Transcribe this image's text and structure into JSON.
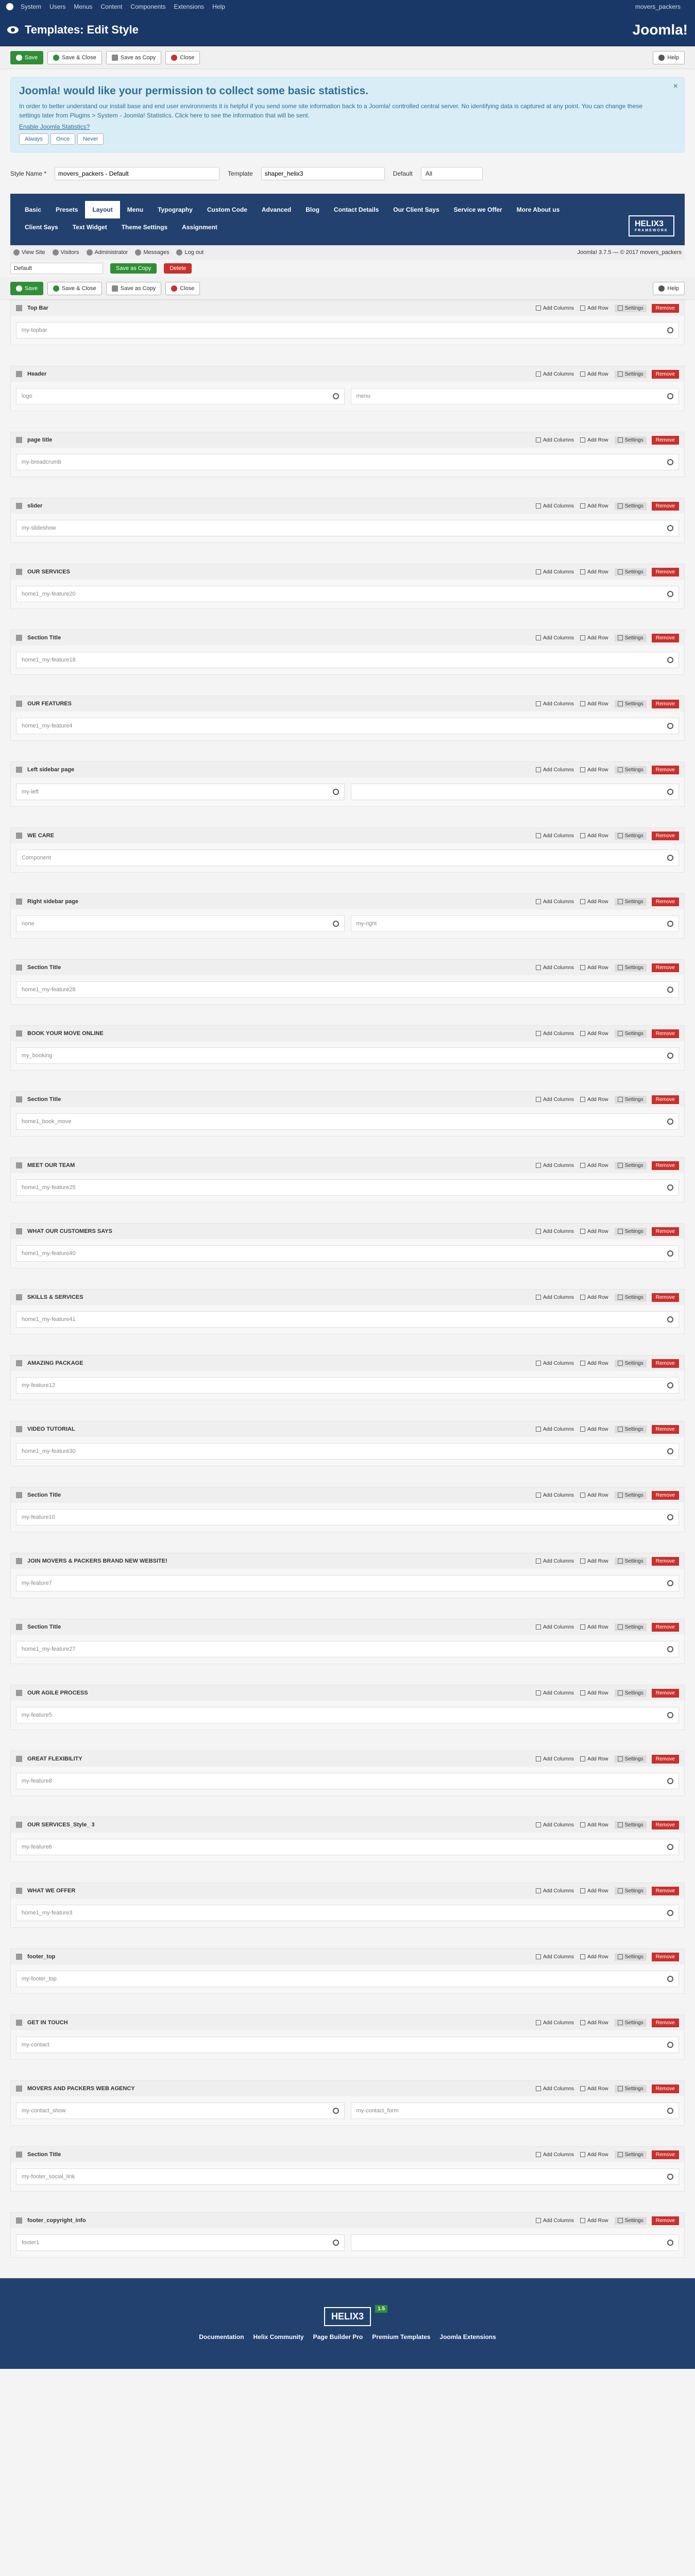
{
  "topmenu": {
    "items": [
      "System",
      "Users",
      "Menus",
      "Content",
      "Components",
      "Extensions",
      "Help"
    ],
    "right": "movers_packers"
  },
  "title": "Templates: Edit Style",
  "brand": "Joomla!",
  "toolbar": {
    "save": "Save",
    "save_close": "Save & Close",
    "save_copy": "Save as Copy",
    "close": "Close",
    "help": "Help"
  },
  "alert": {
    "heading": "Joomla! would like your permission to collect some basic statistics.",
    "text": "In order to better understand our install base and end user environments it is helpful if you send some site information back to a Joomla! controlled central server. No identifying data is captured at any point. You can change these settings later from Plugins > System - Joomla! Statistics. Click here to see the information that will be sent.",
    "link": "Enable Joomla Statistics?",
    "always": "Always",
    "once": "Once",
    "never": "Never"
  },
  "fields": {
    "style_label": "Style Name *",
    "style_value": "movers_packers - Default",
    "template_label": "Template",
    "template_value": "shaper_helix3",
    "default_label": "Default",
    "default_value": "All"
  },
  "tabs": [
    "Basic",
    "Presets",
    "Layout",
    "Menu",
    "Typography",
    "Custom Code",
    "Advanced",
    "Blog",
    "Contact Details",
    "Our Client Says",
    "Service we Offer",
    "More About us",
    "Client Says",
    "Text Widget",
    "Theme Settings",
    "Assignment"
  ],
  "helix": {
    "name": "HELIX3",
    "sub": "FRAMEWORK"
  },
  "subbar": {
    "view_site": "View Site",
    "visitors": "Visitors",
    "administrator": "Administrator",
    "messages": "Messages",
    "logout": "Log out",
    "right": "Joomla! 3.7.5 — © 2017 movers_packers"
  },
  "mini": {
    "select": "Default",
    "save_copy": "Save as Copy",
    "delete": "Delete"
  },
  "actions": {
    "add_columns": "Add Columns",
    "add_row": "Add Row",
    "settings": "Settings",
    "remove": "Remove"
  },
  "sections": [
    {
      "title": "Top Bar",
      "cols": [
        "my-topbar"
      ]
    },
    {
      "title": "Header",
      "cols": [
        "logo",
        "menu"
      ]
    },
    {
      "title": "page title",
      "cols": [
        "my-breadcrumb"
      ]
    },
    {
      "title": "slider",
      "cols": [
        "my-slideshow"
      ]
    },
    {
      "title": "OUR SERVICES",
      "cols": [
        "home1_my-feature20"
      ]
    },
    {
      "title": "Section Title",
      "cols": [
        "home1_my-feature18"
      ]
    },
    {
      "title": "OUR FEATURES",
      "cols": [
        "home1_my-feature4"
      ]
    },
    {
      "title": "Left sidebar page",
      "cols": [
        "my-left",
        ""
      ]
    },
    {
      "title": "WE CARE",
      "cols": [
        "Component"
      ]
    },
    {
      "title": "Right sidebar page",
      "cols": [
        "none",
        "my-right"
      ]
    },
    {
      "title": "Section Title",
      "cols": [
        "home1_my-feature28"
      ]
    },
    {
      "title": "BOOK YOUR MOVE ONLINE",
      "cols": [
        "my_booking"
      ]
    },
    {
      "title": "Section Title",
      "cols": [
        "home1_book_move"
      ]
    },
    {
      "title": "MEET OUR TEAM",
      "cols": [
        "home1_my-feature25"
      ]
    },
    {
      "title": "WHAT OUR CUSTOMERS SAYS",
      "cols": [
        "home1_my-feature40"
      ]
    },
    {
      "title": "SKILLS & SERVICES",
      "cols": [
        "home1_my-feature41"
      ]
    },
    {
      "title": "AMAZING PACKAGE",
      "cols": [
        "my-feature12"
      ]
    },
    {
      "title": "VIDEO TUTORIAL",
      "cols": [
        "home1_my-feature30"
      ]
    },
    {
      "title": "Section Title",
      "cols": [
        "my-feature10"
      ]
    },
    {
      "title": "JOIN MOVERS & PACKERS BRAND NEW WEBSITE!",
      "cols": [
        "my-feature7"
      ]
    },
    {
      "title": "Section Title",
      "cols": [
        "home1_my-feature27"
      ]
    },
    {
      "title": "OUR AGILE PROCESS",
      "cols": [
        "my-feature5"
      ]
    },
    {
      "title": "GREAT FLEXIBILITY",
      "cols": [
        "my-feature8"
      ]
    },
    {
      "title": "OUR SERVICES_Style_ 3",
      "cols": [
        "my-feature6"
      ]
    },
    {
      "title": "WHAT WE OFFER",
      "cols": [
        "home1_my-feature3"
      ]
    },
    {
      "title": "footer_top",
      "cols": [
        "my-footer_top"
      ]
    },
    {
      "title": "GET IN TOUCH",
      "cols": [
        "my-contact"
      ]
    },
    {
      "title": "MOVERS AND PACKERS WEB AGENCY",
      "cols": [
        "my-contact_show",
        "my-contact_form"
      ]
    },
    {
      "title": "Section Title",
      "cols": [
        "my-footer_social_link"
      ]
    },
    {
      "title": "footer_copyright_info",
      "cols": [
        "footer1",
        ""
      ]
    }
  ],
  "footer": {
    "logo": "HELIX3",
    "version": "1.5",
    "links": [
      "Documentation",
      "Helix Community",
      "Page Builder Pro",
      "Premium Templates",
      "Joomla Extensions"
    ]
  }
}
